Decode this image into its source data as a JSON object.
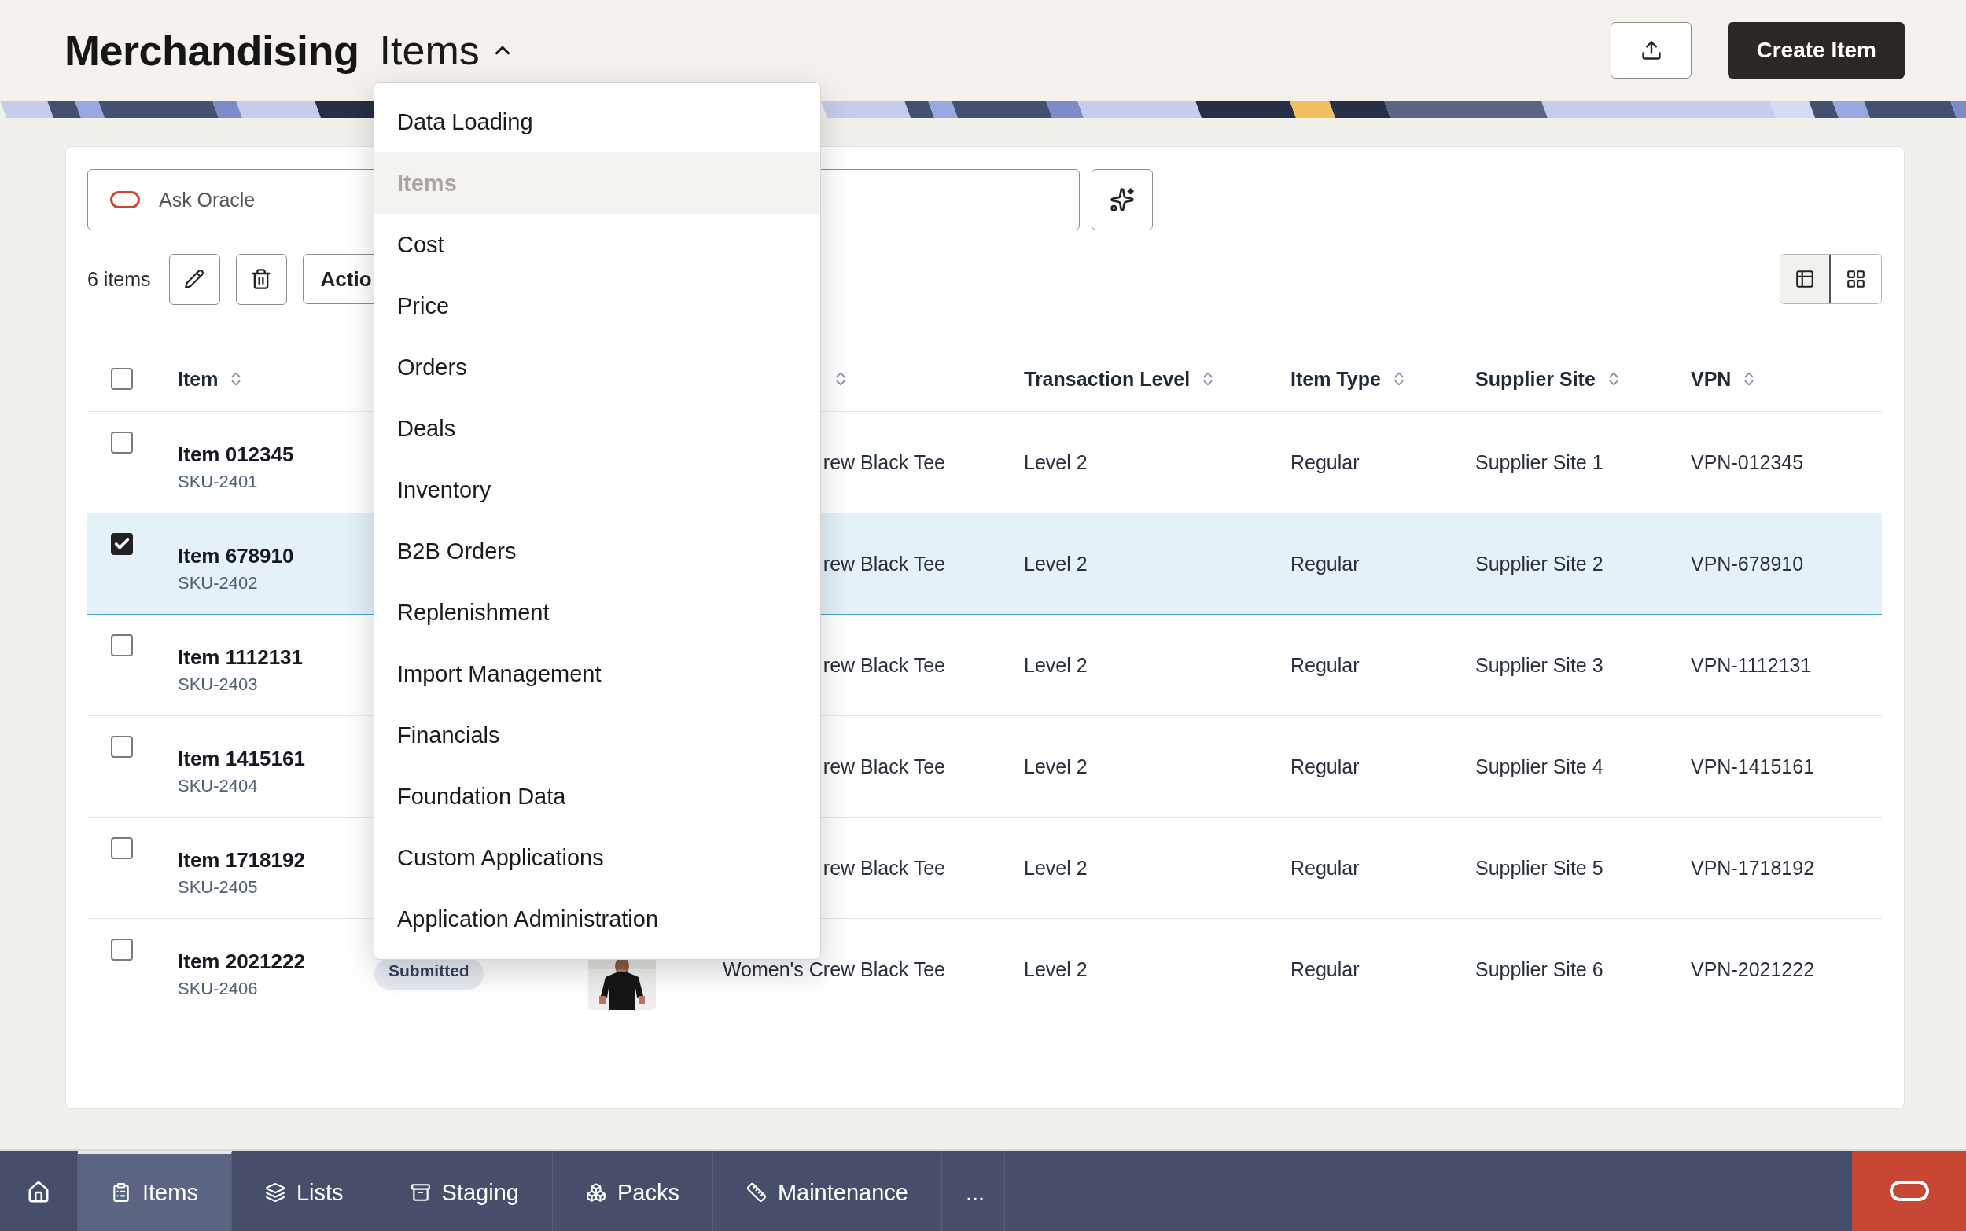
{
  "header": {
    "app_title": "Merchandising",
    "section_title": "Items",
    "expanded": true,
    "create_label": "Create Item"
  },
  "menu": [
    {
      "label": "Data Loading",
      "selected": false
    },
    {
      "label": "Items",
      "selected": true
    },
    {
      "label": "Cost",
      "selected": false
    },
    {
      "label": "Price",
      "selected": false
    },
    {
      "label": "Orders",
      "selected": false
    },
    {
      "label": "Deals",
      "selected": false
    },
    {
      "label": "Inventory",
      "selected": false
    },
    {
      "label": "B2B Orders",
      "selected": false
    },
    {
      "label": "Replenishment",
      "selected": false
    },
    {
      "label": "Import Management",
      "selected": false
    },
    {
      "label": "Financials",
      "selected": false
    },
    {
      "label": "Foundation Data",
      "selected": false
    },
    {
      "label": "Custom Applications",
      "selected": false
    },
    {
      "label": "Application Administration",
      "selected": false
    }
  ],
  "search": {
    "placeholder": "Ask Oracle"
  },
  "toolbar": {
    "count": "6 items",
    "actions_label": "Actio"
  },
  "view_toggle": [
    {
      "kind": "table",
      "selected": true
    },
    {
      "kind": "grid",
      "selected": false
    }
  ],
  "table": {
    "all_checked": false,
    "columns": {
      "item": "Item",
      "transaction_level": "Transaction Level",
      "item_type": "Item Type",
      "supplier_site": "Supplier Site",
      "vpn": "VPN"
    },
    "rows": [
      {
        "name": "Item 012345",
        "sku": "SKU-2401",
        "checked": false,
        "description": "rew Black Tee",
        "level": "Level 2",
        "type": "Regular",
        "site": "Supplier Site 1",
        "vpn": "VPN-012345"
      },
      {
        "name": "Item 678910",
        "sku": "SKU-2402",
        "checked": true,
        "description": "rew Black Tee",
        "level": "Level 2",
        "type": "Regular",
        "site": "Supplier Site 2",
        "vpn": "VPN-678910"
      },
      {
        "name": "Item 1112131",
        "sku": "SKU-2403",
        "checked": false,
        "description": "rew Black Tee",
        "level": "Level 2",
        "type": "Regular",
        "site": "Supplier Site 3",
        "vpn": "VPN-1112131"
      },
      {
        "name": "Item 1415161",
        "sku": "SKU-2404",
        "checked": false,
        "description": "rew Black Tee",
        "level": "Level 2",
        "type": "Regular",
        "site": "Supplier Site 4",
        "vpn": "VPN-1415161"
      },
      {
        "name": "Item 1718192",
        "sku": "SKU-2405",
        "checked": false,
        "description": "rew Black Tee",
        "level": "Level 2",
        "type": "Regular",
        "site": "Supplier Site 5",
        "vpn": "VPN-1718192"
      },
      {
        "name": "Item 2021222",
        "sku": "SKU-2406",
        "checked": false,
        "status": "Submitted",
        "description": "Women's Crew Black Tee",
        "level": "Level 2",
        "type": "Regular",
        "site": "Supplier Site 6",
        "vpn": "VPN-2021222"
      }
    ]
  },
  "bottom_nav": [
    {
      "kind": "home",
      "selected": false
    },
    {
      "kind": "clipboard",
      "label": "Items",
      "selected": true
    },
    {
      "kind": "layers",
      "label": "Lists",
      "selected": false
    },
    {
      "kind": "archive",
      "label": "Staging",
      "selected": false
    },
    {
      "kind": "boxes",
      "label": "Packs",
      "selected": false
    },
    {
      "kind": "ruler",
      "label": "Maintenance",
      "selected": false
    },
    {
      "kind": "more",
      "label": "...",
      "selected": false
    }
  ]
}
